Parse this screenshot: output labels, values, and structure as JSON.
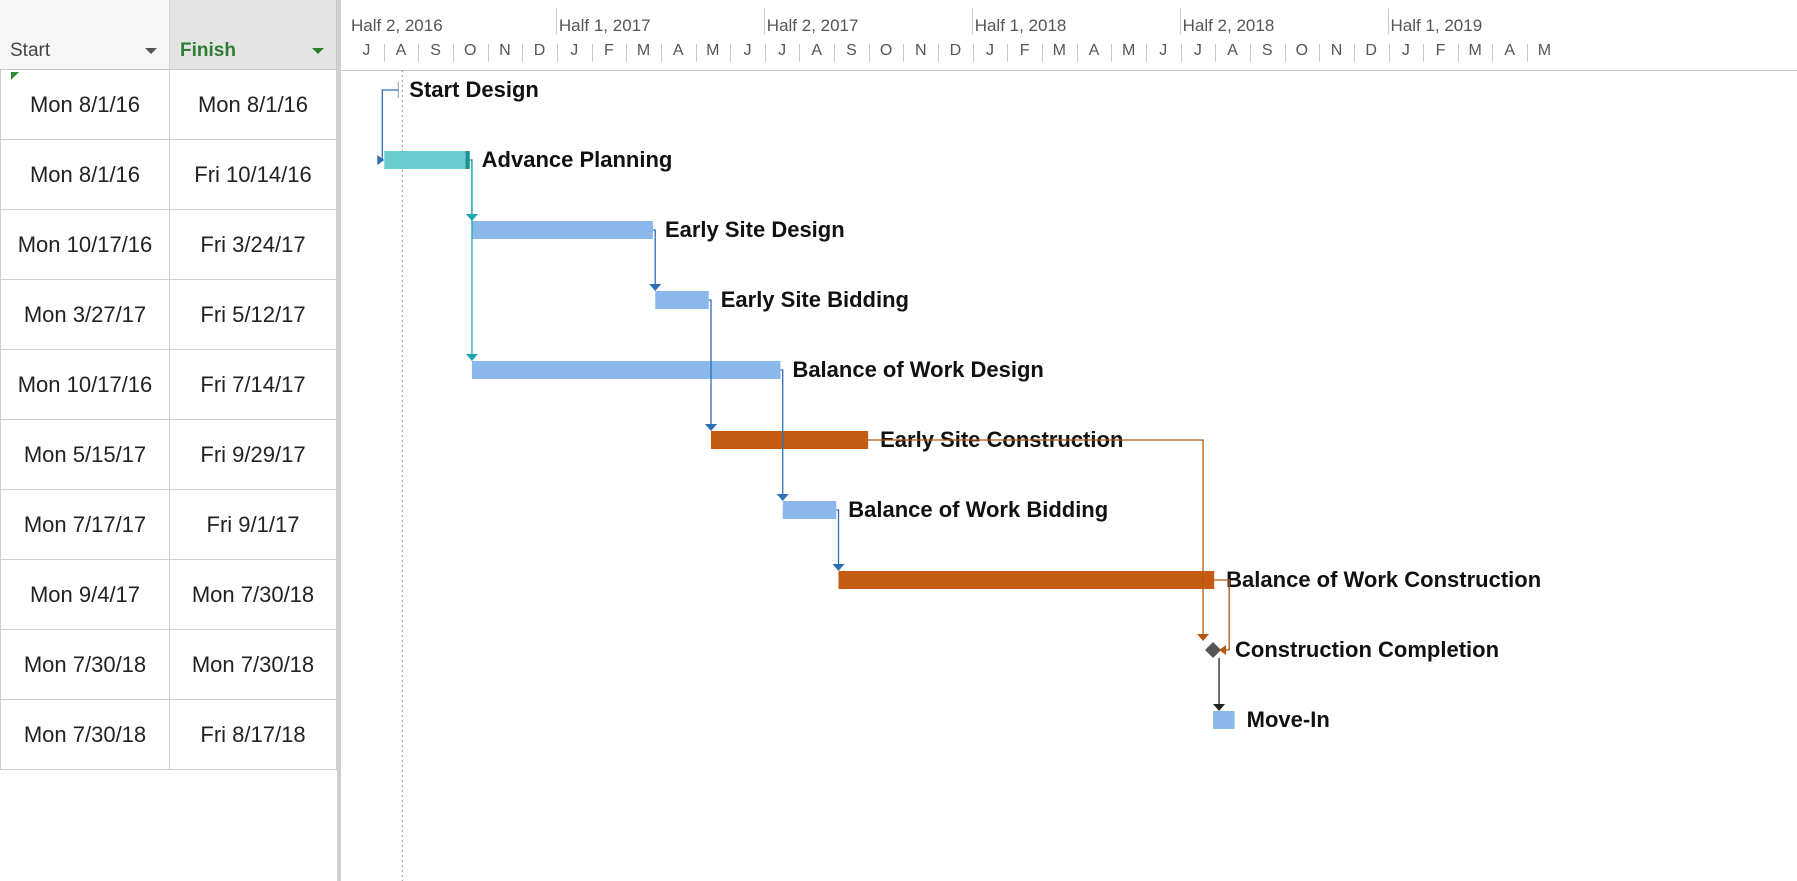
{
  "columns": {
    "start": "Start",
    "finish": "Finish"
  },
  "timescale": {
    "halves": [
      "Half 2, 2016",
      "Half 1, 2017",
      "Half 2, 2017",
      "Half 1, 2018",
      "Half 2, 2018",
      "Half 1, 2019"
    ],
    "months": [
      "J",
      "A",
      "S",
      "O",
      "N",
      "D",
      "J",
      "F",
      "M",
      "A",
      "M",
      "J",
      "J",
      "A",
      "S",
      "O",
      "N",
      "D",
      "J",
      "F",
      "M",
      "A",
      "M",
      "J",
      "J",
      "A",
      "S",
      "O",
      "N",
      "D",
      "J",
      "F",
      "M",
      "A",
      "M"
    ]
  },
  "tasks": [
    {
      "name": "Start Design",
      "start": "Mon 8/1/16",
      "finish": "Mon 8/1/16"
    },
    {
      "name": "Advance Planning",
      "start": "Mon 8/1/16",
      "finish": "Fri 10/14/16"
    },
    {
      "name": "Early Site Design",
      "start": "Mon 10/17/16",
      "finish": "Fri 3/24/17"
    },
    {
      "name": "Early Site Bidding",
      "start": "Mon 3/27/17",
      "finish": "Fri 5/12/17"
    },
    {
      "name": "Balance of Work Design",
      "start": "Mon 10/17/16",
      "finish": "Fri 7/14/17"
    },
    {
      "name": "Early Site Construction",
      "start": "Mon 5/15/17",
      "finish": "Fri 9/29/17"
    },
    {
      "name": "Balance of Work Bidding",
      "start": "Mon 7/17/17",
      "finish": "Fri 9/1/17"
    },
    {
      "name": "Balance of Work Construction",
      "start": "Mon 9/4/17",
      "finish": "Mon 7/30/18"
    },
    {
      "name": "Construction Completion",
      "start": "Mon 7/30/18",
      "finish": "Mon 7/30/18"
    },
    {
      "name": "Move-In",
      "start": "Mon 7/30/18",
      "finish": "Fri 8/17/18"
    }
  ],
  "colors": {
    "bar_blue": "#8ab8ea",
    "bar_teal": "#6ccbcf",
    "bar_orange": "#c55a11",
    "milestone": "#555555"
  }
}
